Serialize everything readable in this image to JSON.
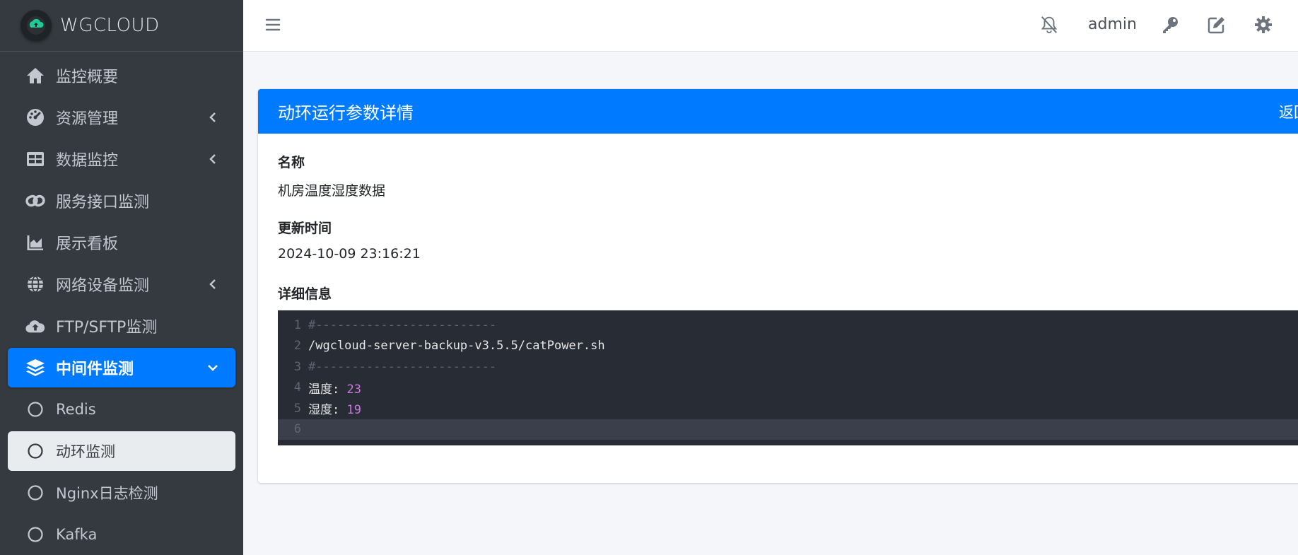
{
  "brand": {
    "name": "WGCLOUD"
  },
  "sidebar": {
    "items": [
      {
        "label": "监控概要",
        "icon": "home-icon",
        "has_chevron": false
      },
      {
        "label": "资源管理",
        "icon": "dashboard-gauge-icon",
        "has_chevron": true
      },
      {
        "label": "数据监控",
        "icon": "table-icon",
        "has_chevron": true
      },
      {
        "label": "服务接口监测",
        "icon": "link-icon",
        "has_chevron": false
      },
      {
        "label": "展示看板",
        "icon": "area-chart-icon",
        "has_chevron": false
      },
      {
        "label": "网络设备监测",
        "icon": "globe-icon",
        "has_chevron": true
      },
      {
        "label": "FTP/SFTP监测",
        "icon": "cloud-upload-icon",
        "has_chevron": false
      },
      {
        "label": "中间件监测",
        "icon": "layers-icon",
        "has_chevron": true,
        "active": true
      },
      {
        "label": "Redis",
        "icon": "circle-icon",
        "sub": true
      },
      {
        "label": "动环监测",
        "icon": "circle-icon",
        "sub": true,
        "selected": true
      },
      {
        "label": "Nginx日志检测",
        "icon": "circle-icon",
        "sub": true
      },
      {
        "label": "Kafka",
        "icon": "circle-icon",
        "sub": true
      }
    ]
  },
  "topbar": {
    "username": "admin",
    "icons": [
      "menu-icon",
      "bell-slash-icon",
      "key-icon",
      "edit-icon",
      "gear-icon"
    ]
  },
  "card": {
    "title": "动环运行参数详情",
    "back_label": "返回",
    "fields": {
      "name_label": "名称",
      "name_value": "机房温度湿度数据",
      "time_label": "更新时间",
      "time_value": "2024-10-09 23:16:21",
      "detail_label": "详细信息"
    },
    "code_lines": [
      {
        "num": "1",
        "text": "#-------------------------"
      },
      {
        "num": "2",
        "text": "/wgcloud-server-backup-v3.5.5/catPower.sh"
      },
      {
        "num": "3",
        "text": "#-------------------------"
      },
      {
        "num": "4",
        "key": "温度: ",
        "value": "23"
      },
      {
        "num": "5",
        "key": "湿度: ",
        "value": "19"
      },
      {
        "num": "6",
        "text": ""
      }
    ]
  },
  "colors": {
    "sidebar_bg": "#343a40",
    "primary": "#007bff",
    "code_bg": "#282c34",
    "code_number": "#c678dd"
  }
}
